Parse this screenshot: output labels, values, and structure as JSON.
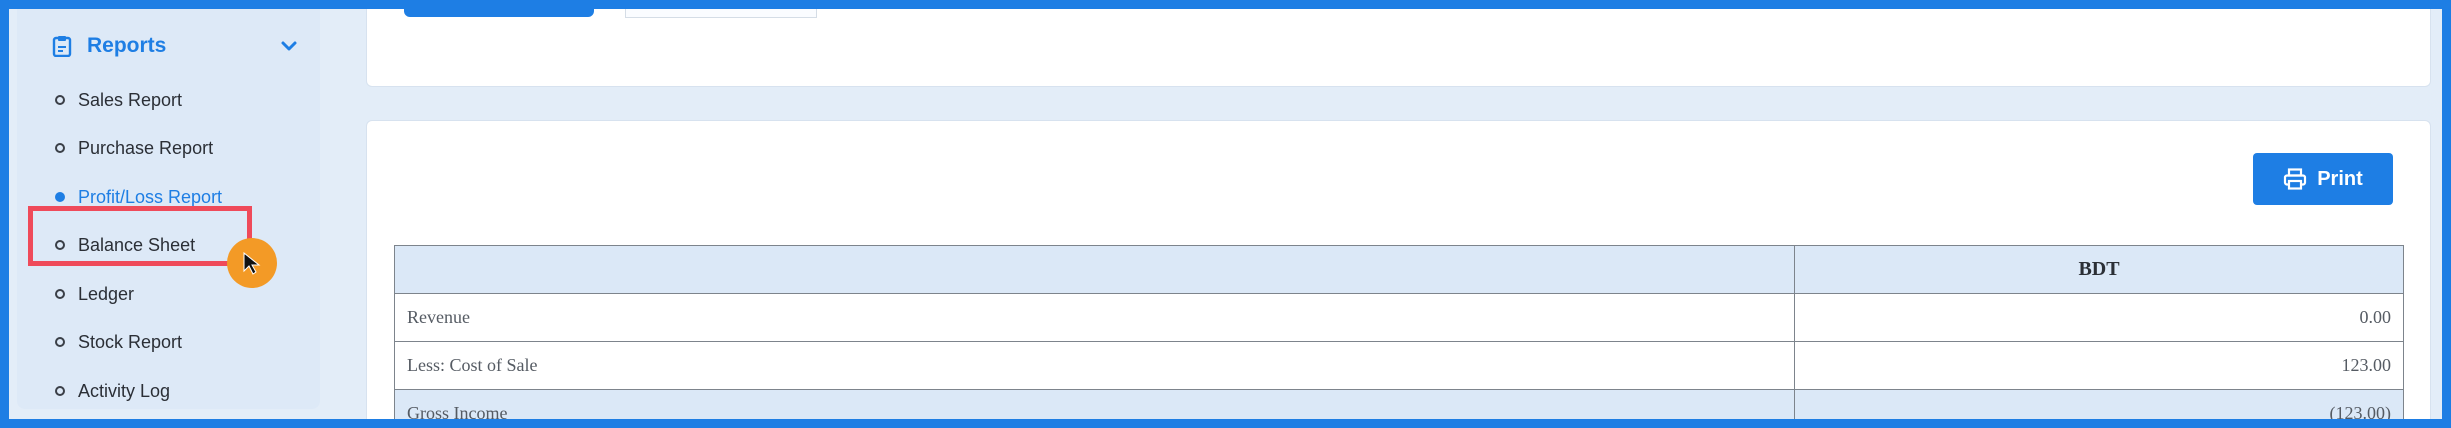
{
  "sidebar": {
    "section_title": "Reports",
    "section_icon": "clipboard-icon",
    "items": [
      {
        "label": "Sales Report",
        "active": false
      },
      {
        "label": "Purchase Report",
        "active": false
      },
      {
        "label": "Profit/Loss Report",
        "active": true
      },
      {
        "label": "Balance Sheet",
        "active": false
      },
      {
        "label": "Ledger",
        "active": false
      },
      {
        "label": "Stock Report",
        "active": false
      },
      {
        "label": "Activity Log",
        "active": false
      }
    ]
  },
  "toolbar": {
    "print_label": "Print",
    "print_icon": "printer-icon"
  },
  "table": {
    "headers": [
      "",
      "BDT"
    ],
    "rows": [
      {
        "label": "Revenue",
        "amount": "0.00"
      },
      {
        "label": "Less: Cost of Sale",
        "amount": "123.00"
      },
      {
        "label": "Gross Income",
        "amount": "(123.00)"
      }
    ]
  },
  "colors": {
    "accent": "#1e7ee4",
    "highlight": "#ef4a5a",
    "cursor": "#f39a26"
  }
}
